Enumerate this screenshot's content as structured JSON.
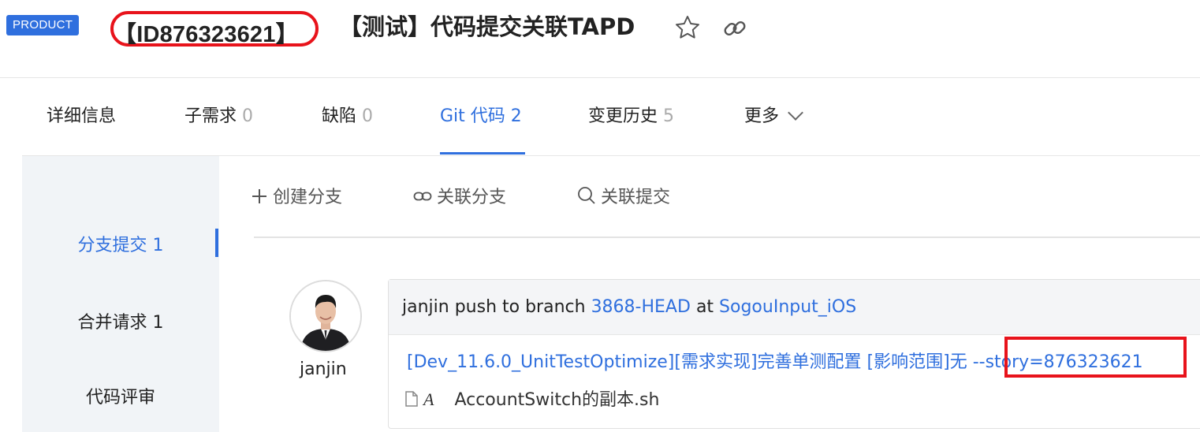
{
  "header": {
    "badge": "PRODUCT",
    "story_id": "【ID876323621】",
    "title": "【测试】代码提交关联TAPD"
  },
  "tabs": [
    {
      "label": "详细信息",
      "count": ""
    },
    {
      "label": "子需求",
      "count": "0"
    },
    {
      "label": "缺陷",
      "count": "0"
    },
    {
      "label": "Git 代码",
      "count": "2"
    },
    {
      "label": "变更历史",
      "count": "5"
    },
    {
      "label": "更多",
      "count": ""
    }
  ],
  "sidebar": {
    "items": [
      {
        "label": "分支提交 1"
      },
      {
        "label": "合并请求 1"
      },
      {
        "label": "代码评审"
      }
    ]
  },
  "actions": {
    "create_branch": "创建分支",
    "link_branch": "关联分支",
    "link_commit": "关联提交"
  },
  "commit": {
    "author": "janjin",
    "head_prefix": "janjin push to branch",
    "branch": "3868-HEAD",
    "at": "at",
    "repo": "SogouInput_iOS",
    "message": "[Dev_11.6.0_UnitTestOptimize][需求实现]完善单测配置 [影响范围]无 --story=876323621",
    "file_type": "A",
    "file_name": "AccountSwitch的副本.sh"
  },
  "colors": {
    "accent": "#2f6fde",
    "highlight": "#e8131b",
    "sidebar_bg": "#f1f4f7"
  }
}
